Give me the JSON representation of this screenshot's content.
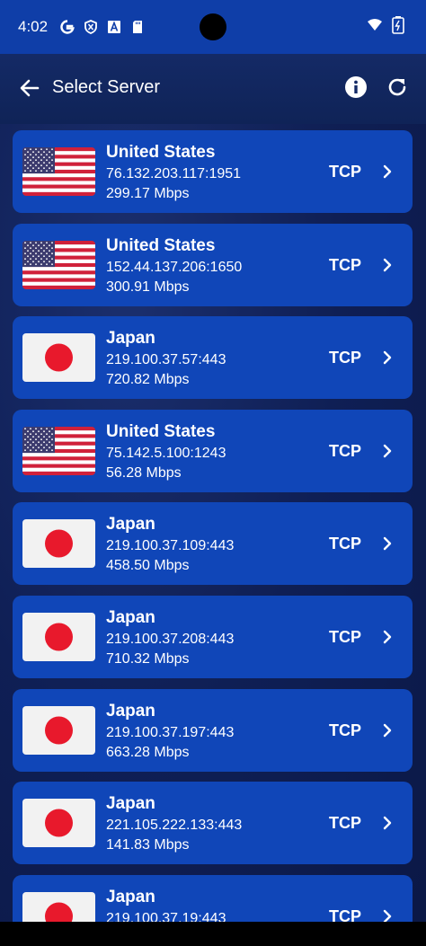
{
  "status_bar": {
    "time": "4:02",
    "left_icons": [
      "google-icon",
      "shield-icon",
      "a-icon",
      "sd-card-icon"
    ],
    "right_icons": [
      "wifi-icon",
      "battery-icon"
    ]
  },
  "header": {
    "title": "Select Server",
    "icons": [
      "back-arrow-icon",
      "info-icon",
      "refresh-icon"
    ]
  },
  "servers": [
    {
      "country": "United States",
      "flag": "us",
      "address": "76.132.203.117:1951",
      "speed": "299.17 Mbps",
      "protocol": "TCP"
    },
    {
      "country": "United States",
      "flag": "us",
      "address": "152.44.137.206:1650",
      "speed": "300.91 Mbps",
      "protocol": "TCP"
    },
    {
      "country": "Japan",
      "flag": "jp",
      "address": "219.100.37.57:443",
      "speed": "720.82 Mbps",
      "protocol": "TCP"
    },
    {
      "country": "United States",
      "flag": "us",
      "address": "75.142.5.100:1243",
      "speed": "56.28 Mbps",
      "protocol": "TCP"
    },
    {
      "country": "Japan",
      "flag": "jp",
      "address": "219.100.37.109:443",
      "speed": "458.50 Mbps",
      "protocol": "TCP"
    },
    {
      "country": "Japan",
      "flag": "jp",
      "address": "219.100.37.208:443",
      "speed": "710.32 Mbps",
      "protocol": "TCP"
    },
    {
      "country": "Japan",
      "flag": "jp",
      "address": "219.100.37.197:443",
      "speed": "663.28 Mbps",
      "protocol": "TCP"
    },
    {
      "country": "Japan",
      "flag": "jp",
      "address": "221.105.222.133:443",
      "speed": "141.83 Mbps",
      "protocol": "TCP"
    },
    {
      "country": "Japan",
      "flag": "jp",
      "address": "219.100.37.19:443",
      "speed": "",
      "protocol": "TCP"
    }
  ],
  "colors": {
    "status_bar": "#0f3ea8",
    "card": "#1046b8",
    "background": "#0d1b4a",
    "japan_red": "#e8192c"
  }
}
